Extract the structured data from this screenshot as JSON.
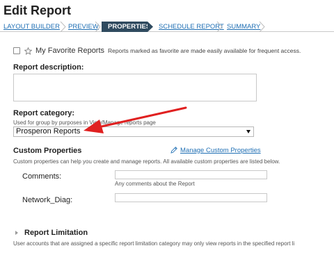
{
  "page": {
    "title": "Edit Report"
  },
  "wizard": {
    "steps": [
      {
        "label": "LAYOUT BUILDER"
      },
      {
        "label": "PREVIEW"
      },
      {
        "label": "PROPERTIES"
      },
      {
        "label": "SCHEDULE REPORT"
      },
      {
        "label": "SUMMARY"
      }
    ],
    "active_index": 2
  },
  "favorite": {
    "checked": false,
    "label": "My Favorite Reports",
    "hint": "Reports marked as favorite are made easily available for frequent access."
  },
  "description": {
    "label": "Report description:",
    "value": ""
  },
  "category": {
    "label": "Report category:",
    "helper": "Used for group by purposes in View/Manage reports page",
    "selected": "Prosperon Reports"
  },
  "custom_properties": {
    "title": "Custom Properties",
    "manage_link": "Manage Custom Properties",
    "helper": "Custom properties can help you create and manage reports. All available custom properties are listed below.",
    "fields": [
      {
        "label": "Comments:",
        "value": "",
        "hint": "Any comments about the Report"
      },
      {
        "label": "Network_Diag:",
        "value": "",
        "hint": ""
      }
    ]
  },
  "report_limitation": {
    "title": "Report Limitation",
    "helper": "User accounts that are assigned a specific report limitation category may only view reports in the specified report li"
  },
  "colors": {
    "accent": "#1f6fb4",
    "active_step_bg": "#2f4a5f",
    "annotation_arrow": "#e02020"
  },
  "icons": {
    "favorite": "star-outline-icon",
    "manage": "pencil-icon",
    "dropdown": "caret-down-icon",
    "expand": "caret-right-icon"
  }
}
